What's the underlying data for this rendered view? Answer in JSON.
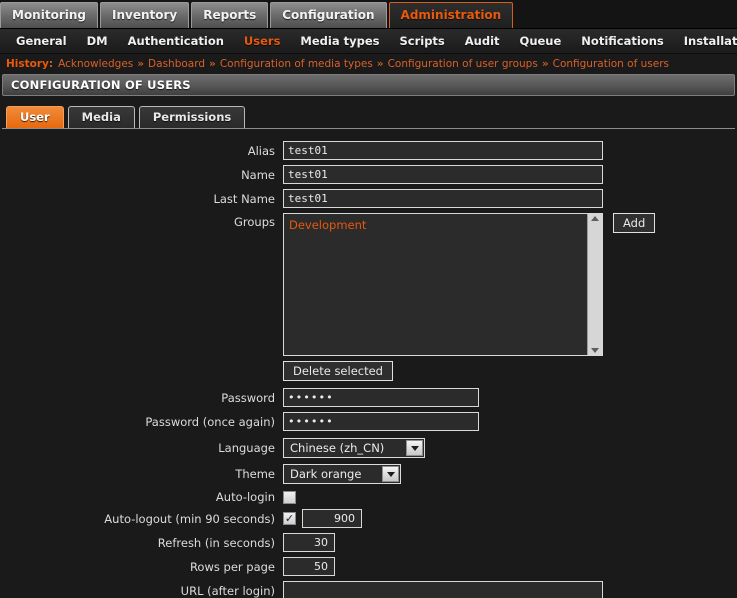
{
  "topnav": {
    "items": [
      {
        "label": "Monitoring",
        "active": false
      },
      {
        "label": "Inventory",
        "active": false
      },
      {
        "label": "Reports",
        "active": false
      },
      {
        "label": "Configuration",
        "active": false
      },
      {
        "label": "Administration",
        "active": true
      }
    ]
  },
  "subnav": {
    "items": [
      {
        "label": "General",
        "active": false
      },
      {
        "label": "DM",
        "active": false
      },
      {
        "label": "Authentication",
        "active": false
      },
      {
        "label": "Users",
        "active": true
      },
      {
        "label": "Media types",
        "active": false
      },
      {
        "label": "Scripts",
        "active": false
      },
      {
        "label": "Audit",
        "active": false
      },
      {
        "label": "Queue",
        "active": false
      },
      {
        "label": "Notifications",
        "active": false
      },
      {
        "label": "Installation",
        "active": false
      }
    ]
  },
  "history": {
    "label": "History:",
    "separator": "»",
    "links": [
      "Acknowledges",
      "Dashboard",
      "Configuration of media types",
      "Configuration of user groups",
      "Configuration of users"
    ]
  },
  "page": {
    "title": "CONFIGURATION OF USERS"
  },
  "form_tabs": [
    {
      "label": "User",
      "active": true
    },
    {
      "label": "Media",
      "active": false
    },
    {
      "label": "Permissions",
      "active": false
    }
  ],
  "form": {
    "alias": {
      "label": "Alias",
      "value": "test01"
    },
    "name": {
      "label": "Name",
      "value": "test01"
    },
    "last_name": {
      "label": "Last Name",
      "value": "test01"
    },
    "groups": {
      "label": "Groups",
      "items": [
        "Development"
      ],
      "add_button": "Add",
      "delete_button": "Delete selected"
    },
    "password": {
      "label": "Password",
      "value": "••••••"
    },
    "password_again": {
      "label": "Password (once again)",
      "value": "••••••"
    },
    "language": {
      "label": "Language",
      "value": "Chinese (zh_CN)"
    },
    "theme": {
      "label": "Theme",
      "value": "Dark orange"
    },
    "auto_login": {
      "label": "Auto-login",
      "checked": false
    },
    "auto_logout": {
      "label": "Auto-logout (min 90 seconds)",
      "checked": true,
      "value": "900"
    },
    "refresh": {
      "label": "Refresh (in seconds)",
      "value": "30"
    },
    "rows_per_page": {
      "label": "Rows per page",
      "value": "50"
    },
    "url_after_login": {
      "label": "URL (after login)",
      "value": ""
    }
  },
  "colors": {
    "accent": "#e8590c",
    "background": "#1a1a1a",
    "input_bg": "#2b2b2b",
    "input_border": "#d8d8d8"
  }
}
